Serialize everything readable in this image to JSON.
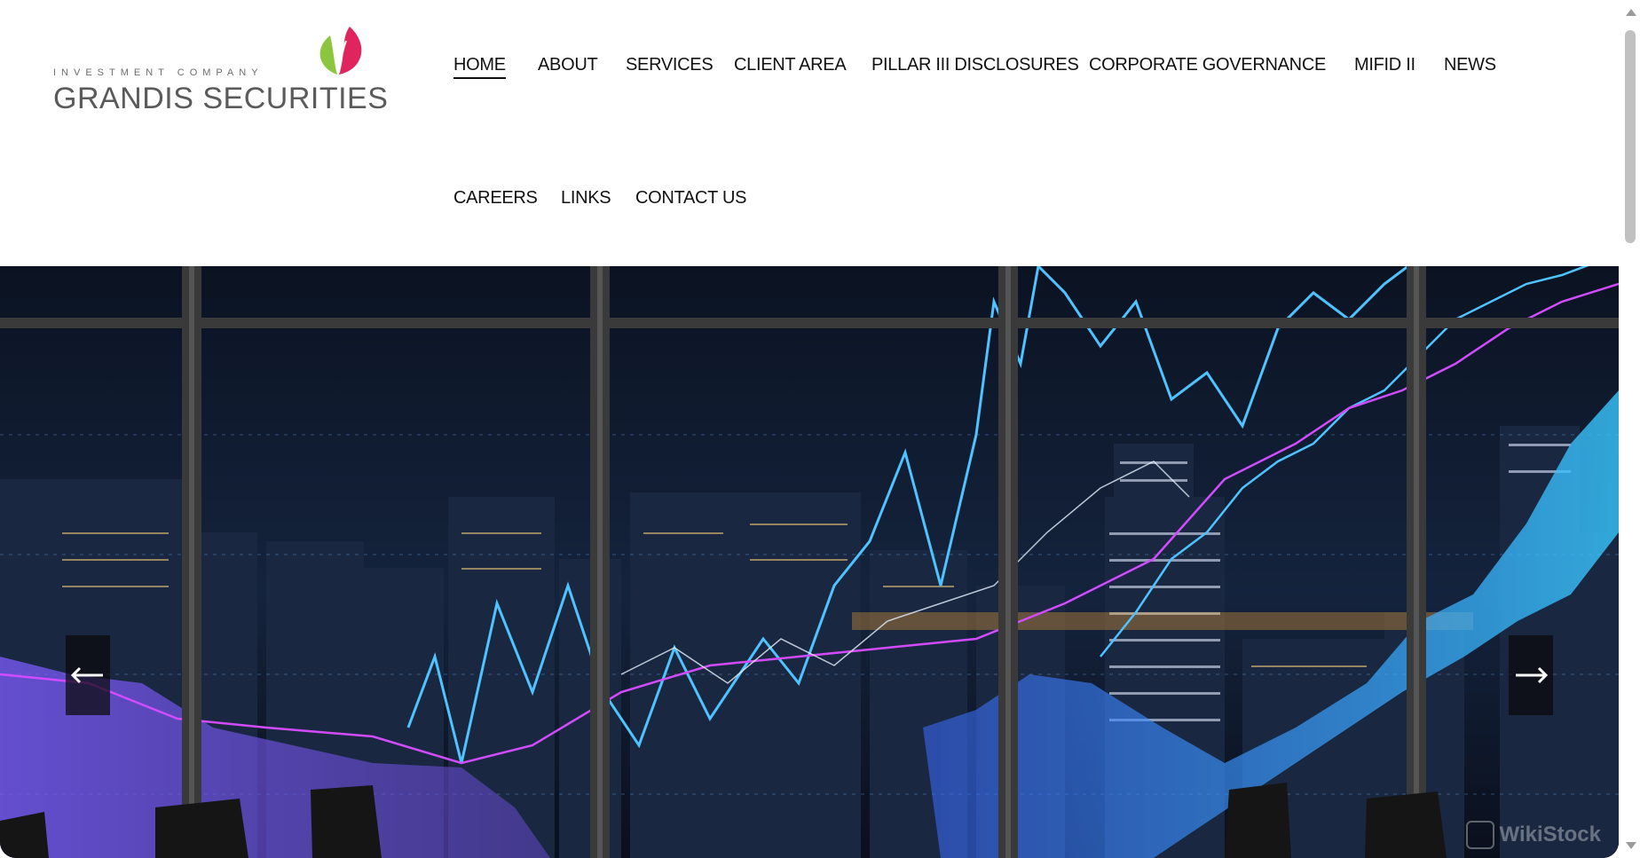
{
  "brand": {
    "tagline": "INVESTMENT COMPANY",
    "name": "GRANDIS SECURITIES",
    "leaf_green": "#8cc63f",
    "leaf_red": "#e0245e"
  },
  "nav": {
    "items": [
      {
        "label": "HOME",
        "active": true
      },
      {
        "label": "ABOUT"
      },
      {
        "label": "SERVICES"
      },
      {
        "label": "CLIENT AREA"
      },
      {
        "label": "PILLAR III DISCLOSURES"
      },
      {
        "label": "CORPORATE GOVERNANCE"
      },
      {
        "label": "MIFID II"
      },
      {
        "label": "NEWS"
      },
      {
        "label": "CAREERS"
      },
      {
        "label": "LINKS"
      },
      {
        "label": "CONTACT US"
      }
    ]
  },
  "hero": {
    "icons": {
      "prev": "arrow-left-icon",
      "next": "arrow-right-icon"
    },
    "colors": {
      "sky": "#0c1426",
      "cyan": "#3fb4ff",
      "magenta": "#d24cff",
      "violet": "#7a6cff"
    }
  },
  "watermark": {
    "text": "WikiStock"
  }
}
